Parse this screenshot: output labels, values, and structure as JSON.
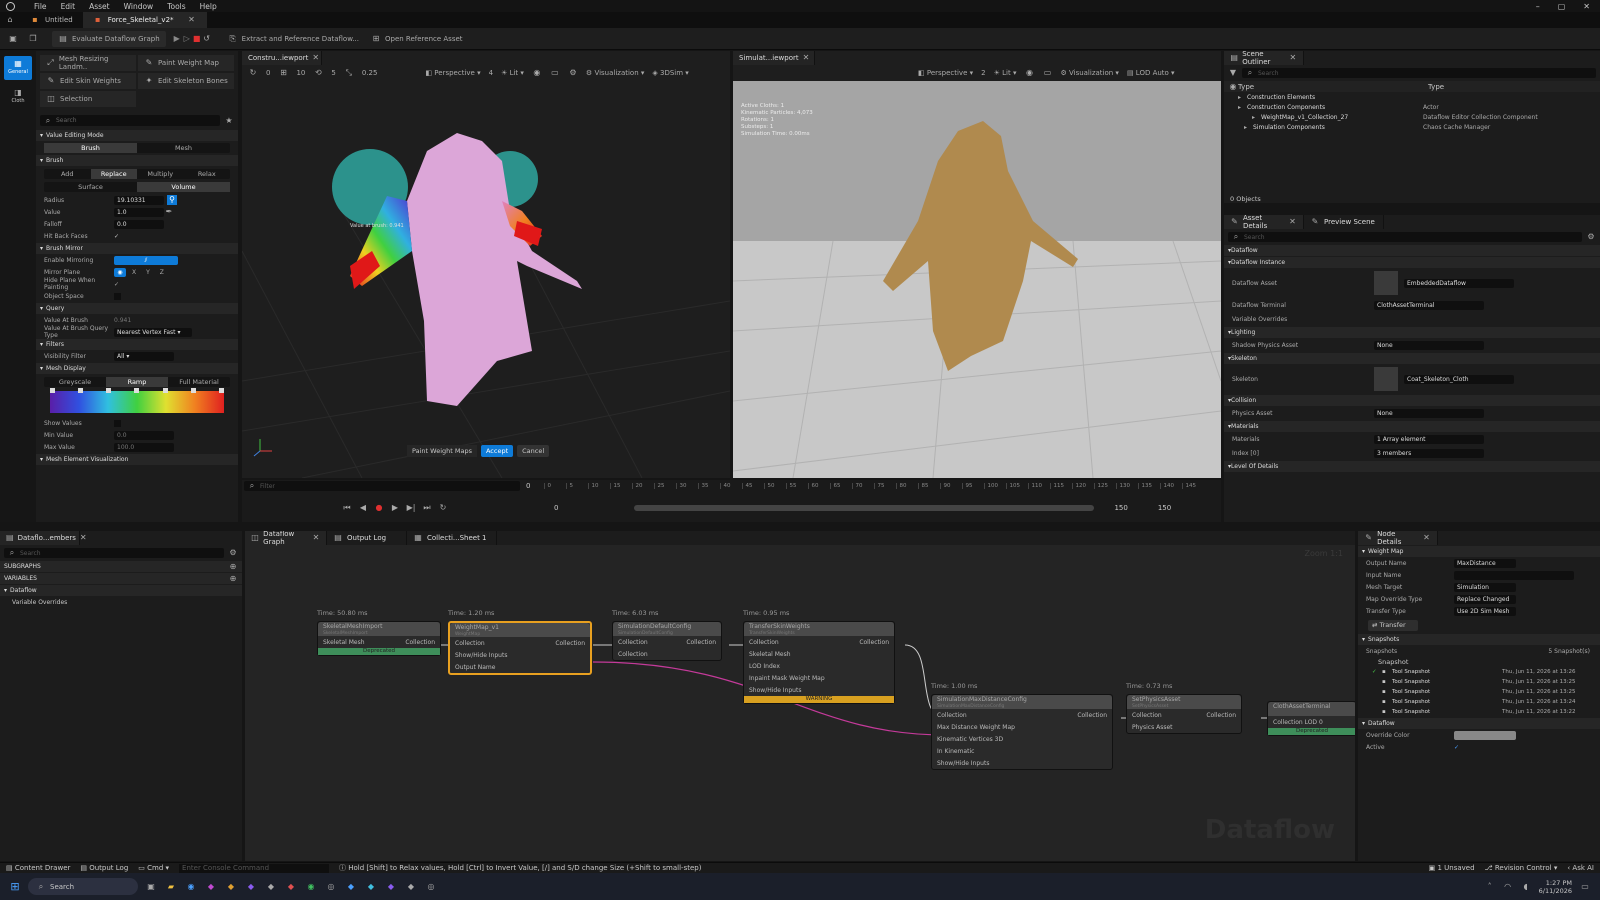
{
  "menu": [
    "File",
    "Edit",
    "Asset",
    "Window",
    "Tools",
    "Help"
  ],
  "doc_tabs": [
    {
      "label": "Untitled"
    },
    {
      "label": "Force_Skeletal_v2*"
    }
  ],
  "toolbar": {
    "evaluate": "Evaluate Dataflow Graph",
    "extract": "Extract and Reference Dataflow...",
    "open_ref": "Open Reference Asset"
  },
  "left_sidebar": {
    "general": "General",
    "cloth": "Cloth"
  },
  "tools_panel": {
    "buttons": [
      "Mesh Resizing Landm..",
      "Paint Weight Map",
      "Edit Skin Weights",
      "Edit Skeleton Bones",
      "Selection"
    ],
    "search_placeholder": "Search"
  },
  "brush": {
    "value_editing_mode": "Value Editing Mode",
    "mode_tabs": [
      "Brush",
      "Mesh"
    ],
    "brush_title": "Brush",
    "ops": [
      "Add",
      "Replace",
      "Multiply",
      "Relax"
    ],
    "areas": [
      "Surface",
      "Volume"
    ],
    "radius_label": "Radius",
    "radius": "19.10331",
    "value_label": "Value",
    "value": "1.0",
    "falloff_label": "Falloff",
    "falloff": "0.0",
    "hit_back_label": "Hit Back Faces",
    "mirror_title": "Brush Mirror",
    "enable_mirroring": "Enable Mirroring",
    "mirror_plane": "Mirror Plane",
    "mirror_axes": [
      "X",
      "Y",
      "Z"
    ],
    "hide_plane": "Hide Plane When Painting",
    "object_space": "Object Space",
    "query_title": "Query",
    "value_at_brush_label": "Value At Brush",
    "value_at_brush": "0.941",
    "query_type_label": "Value At Brush Query Type",
    "query_type": "Nearest Vertex Fast",
    "filters_title": "Filters",
    "visibility_label": "Visibility Filter",
    "visibility": "All",
    "mesh_display_title": "Mesh Display",
    "display_modes": [
      "Greyscale",
      "Ramp",
      "Full Material"
    ],
    "show_values": "Show Values",
    "min_value_label": "Min Value",
    "min_value": "0.0",
    "max_value_label": "Max Value",
    "max_value": "100.0",
    "mesh_element": "Mesh Element Visualization"
  },
  "viewport1": {
    "tab": "Constru...iewport",
    "perspective": "Perspective",
    "lit": "Lit",
    "visualization": "Visualization",
    "sim3d": "3DSim",
    "nums": [
      "0",
      "10",
      "5",
      "0.25",
      "4"
    ],
    "brush_label": "Value at brush: 0.941",
    "paint_label": "Paint Weight Maps",
    "accept": "Accept",
    "cancel": "Cancel"
  },
  "viewport2": {
    "tab": "Simulat...iewport",
    "perspective": "Perspective",
    "lit": "Lit",
    "visualization": "Visualization",
    "lod": "LOD Auto",
    "num": "2",
    "stats": [
      "Active Cloths: 1",
      "Kinematic Particles: 4,073",
      "Rotations: 1",
      "Substeps: 1",
      "Simulation Time: 0.00ms"
    ]
  },
  "timeline": {
    "filter_placeholder": "Filter",
    "start": "0",
    "end": "150",
    "end2": "150",
    "cur": "0",
    "ticks": [
      "0",
      "5",
      "10",
      "15",
      "20",
      "25",
      "30",
      "35",
      "40",
      "45",
      "50",
      "55",
      "60",
      "65",
      "70",
      "75",
      "80",
      "85",
      "90",
      "95",
      "100",
      "105",
      "110",
      "115",
      "120",
      "125",
      "130",
      "135",
      "140",
      "145"
    ]
  },
  "outliner": {
    "tab": "Scene Outliner",
    "search": "Search",
    "col_type": "Type",
    "col_type2": "Type",
    "rows": [
      {
        "name": "Construction Elements",
        "type": ""
      },
      {
        "name": "Construction Components",
        "type": "Actor"
      },
      {
        "name": "WeightMap_v1_Collection_27",
        "type": "Dataflow Editor Collection Component"
      },
      {
        "name": "Simulation Components",
        "type": "Chaos Cache Manager"
      }
    ],
    "count": "0 Objects"
  },
  "asset_details": {
    "tab": "Asset Details",
    "tab2": "Preview Scene",
    "search": "Search",
    "sections": [
      {
        "title": "Dataflow",
        "props": []
      },
      {
        "title": "Dataflow Instance",
        "props": [
          {
            "label": "Dataflow Asset",
            "value": "EmbeddedDataflow"
          },
          {
            "label": "Dataflow Terminal",
            "value": "ClothAssetTerminal"
          },
          {
            "label": "Variable Overrides",
            "value": ""
          }
        ]
      },
      {
        "title": "Lighting",
        "props": [
          {
            "label": "Shadow Physics Asset",
            "value": "None"
          }
        ]
      },
      {
        "title": "Skeleton",
        "props": [
          {
            "label": "Skeleton",
            "value": "Coat_Skeleton_Cloth"
          }
        ]
      },
      {
        "title": "Collision",
        "props": [
          {
            "label": "Physics Asset",
            "value": "None"
          }
        ]
      },
      {
        "title": "Materials",
        "props": [
          {
            "label": "Materials",
            "value": "1 Array element"
          },
          {
            "label": "Index [0]",
            "value": "3 members"
          }
        ]
      },
      {
        "title": "Level Of Details",
        "props": []
      }
    ]
  },
  "members": {
    "tab": "Dataflo...embers",
    "search": "Search",
    "subgraphs": "SUBGRAPHS",
    "variables": "VARIABLES",
    "dataflow": "Dataflow",
    "var_overrides": "Variable Overrides"
  },
  "graph": {
    "tabs": [
      "Dataflow Graph",
      "Output Log",
      "Collecti...Sheet 1"
    ],
    "zoom": "Zoom 1:1",
    "watermark": "Dataflow",
    "nodes": [
      {
        "time": "Time: 50.80 ms",
        "title": "SkeletalMeshImport",
        "sub": "SkeletalMeshImport",
        "pins": [
          "Skeletal Mesh",
          "Collection"
        ],
        "footer": "Deprecated"
      },
      {
        "time": "Time: 1.20 ms",
        "title": "WeightMap_v1",
        "sub": "WeightMap",
        "pins": [
          "Collection",
          "Collection",
          "Show/Hide Inputs",
          "Output Name"
        ]
      },
      {
        "time": "Time: 6.03 ms",
        "title": "SimulationDefaultConfig",
        "sub": "SimulationDefaultConfig",
        "pins": [
          "Collection",
          "Collection"
        ]
      },
      {
        "time": "Time: 0.95 ms",
        "title": "TransferSkinWeights",
        "sub": "TransferSkinWeights",
        "pins": [
          "Collection",
          "Collection",
          "Skeletal Mesh",
          "LOD Index",
          "Inpaint Mask Weight Map",
          "Show/Hide Inputs"
        ],
        "footer": "WARNING"
      },
      {
        "time": "Time: 1.00 ms",
        "title": "SimulationMaxDistanceConfig",
        "sub": "SimulationMaxDistanceConfig",
        "pins": [
          "Collection",
          "Collection",
          "Max Distance Weight Map",
          "Kinematic Vertices 3D",
          "In Kinematic",
          "Show/Hide Inputs"
        ]
      },
      {
        "time": "Time: 0.73 ms",
        "title": "SetPhysicsAsset",
        "sub": "SetPhysicsAsset",
        "pins": [
          "Collection",
          "Collection",
          "Physics Asset"
        ]
      },
      {
        "time": "",
        "title": "ClothAssetTerminal",
        "sub": "",
        "pins": [
          "Collection LOD 0"
        ],
        "footer": "Deprecated"
      }
    ]
  },
  "node_details": {
    "tab": "Node Details",
    "weight_map": "Weight Map",
    "props": [
      {
        "label": "Output Name",
        "value": "MaxDistance"
      },
      {
        "label": "Input Name",
        "value": ""
      },
      {
        "label": "Mesh Target",
        "value": "Simulation"
      },
      {
        "label": "Map Override Type",
        "value": "Replace Changed"
      },
      {
        "label": "Transfer Type",
        "value": "Use 2D Sim Mesh"
      }
    ],
    "transfer": "Transfer",
    "snapshots_title": "Snapshots",
    "snapshots": "Snapshots",
    "snapshots_count": "5 Snapshot(s)",
    "snapshot_col": "Snapshot",
    "snapshot_rows": [
      {
        "name": "Tool Snapshot",
        "date": "Thu, Jun 11, 2026 at 13:26"
      },
      {
        "name": "Tool Snapshot",
        "date": "Thu, Jun 11, 2026 at 13:25"
      },
      {
        "name": "Tool Snapshot",
        "date": "Thu, Jun 11, 2026 at 13:25"
      },
      {
        "name": "Tool Snapshot",
        "date": "Thu, Jun 11, 2026 at 13:24"
      },
      {
        "name": "Tool Snapshot",
        "date": "Thu, Jun 11, 2026 at 13:22"
      }
    ],
    "dataflow": "Dataflow",
    "override_color": "Override Color",
    "active": "Active"
  },
  "statusbar": {
    "content_drawer": "Content Drawer",
    "output_log": "Output Log",
    "cmd": "Cmd",
    "console": "Enter Console Command",
    "hint": "Hold [Shift] to Relax values, Hold [Ctrl] to Invert Value, [/] and S/D change Size (+Shift to small-step)",
    "unsaved": "1 Unsaved",
    "revision": "Revision Control",
    "ask": "Ask AI"
  },
  "taskbar": {
    "search": "Search",
    "time": "1:27 PM",
    "date": "6/11/2026"
  },
  "colors": {
    "accent": "#0e7bd8",
    "selected_node": "#e8a020",
    "magenta_wire": "#c43a9a"
  }
}
